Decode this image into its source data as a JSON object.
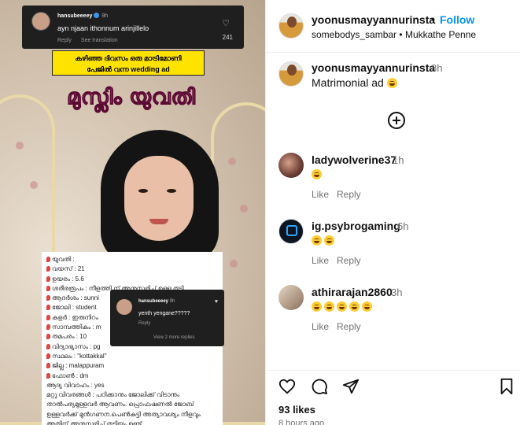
{
  "media": {
    "top_comment": {
      "username": "hansubeeeey",
      "time": "9h",
      "text": "ayn njaan ithonnum arinjillelo",
      "reply_label": "Reply",
      "translate_label": "See translation",
      "like_count": "241"
    },
    "banner_line1": "കഴിഞ്ഞ ദിവസം ഒരു മാട്രിമോണി",
    "banner_line2": "പേജിൽ വന്ന wedding ad",
    "title_overlay": "മുസ്ലിം യുവതി",
    "details": [
      "യുവതി :",
      "വയസ് : 21",
      "ഉയരം : 5.6",
      "ശരീരരൂപം : നീളത്തി ന് അനുസരിച്ച് ഉള്ള തടി",
      "ആദർശം : sunni",
      "ജോലി : student",
      "കളർ : ഇരുനിറം",
      "സാമ്പത്തികം : m",
      "തമപരം : 10",
      "വിദ്യാഭ്യാസം : pg",
      "സ്ഥലം : \"kottakkal\"",
      "ജില്ല : malappuram",
      "ഫോൺ : dm",
      "ആദ്യ വിവാഹം : yes"
    ],
    "details_paragraph": "മറ്റു വിവരങ്ങൾ : പഠിക്കാനും ജോലിക്ക് വിടാനും താൽപര്യമുള്ളവർ ആവണം. പ്രൊഫഷണൽ ജോബ് ഉള്ളവർക്ക് മുൻഗണന.പെൺകുട്ടി അത്യാവശ്യം നീളവും അതിന് അനുസരിച്ച് തടിയും ഉണ്ട്.",
    "mid_comment": {
      "username": "hansubeeeey",
      "time": "9h",
      "text": "yenth yengane?????",
      "reply_label": "Reply",
      "view_replies": "View 2 more replies"
    }
  },
  "header": {
    "username": "yoonusmayyannurinsta",
    "separator": "•",
    "follow_label": "Follow",
    "audio_user": "somebodys_sambar",
    "audio_sep": "•",
    "audio_title": "Mukkathe Penne"
  },
  "caption": {
    "username": "yoonusmayyannurinsta",
    "time": "8h",
    "text": "Matrimonial ad"
  },
  "comments": [
    {
      "username": "ladywolverine37",
      "time": "1h",
      "emoji_count": 1,
      "like_label": "Like",
      "reply_label": "Reply"
    },
    {
      "username": "ig.psybrogaming",
      "time": "6h",
      "emoji_count": 2,
      "like_label": "Like",
      "reply_label": "Reply"
    },
    {
      "username": "athirarajan2860",
      "time": "3h",
      "emoji_count": 5,
      "like_label": "Like",
      "reply_label": "Reply"
    }
  ],
  "footer": {
    "likes": "93 likes",
    "posted": "8 hours ago"
  },
  "icons": [
    "like-icon",
    "comment-icon",
    "share-icon",
    "save-icon",
    "add-comment-icon"
  ]
}
